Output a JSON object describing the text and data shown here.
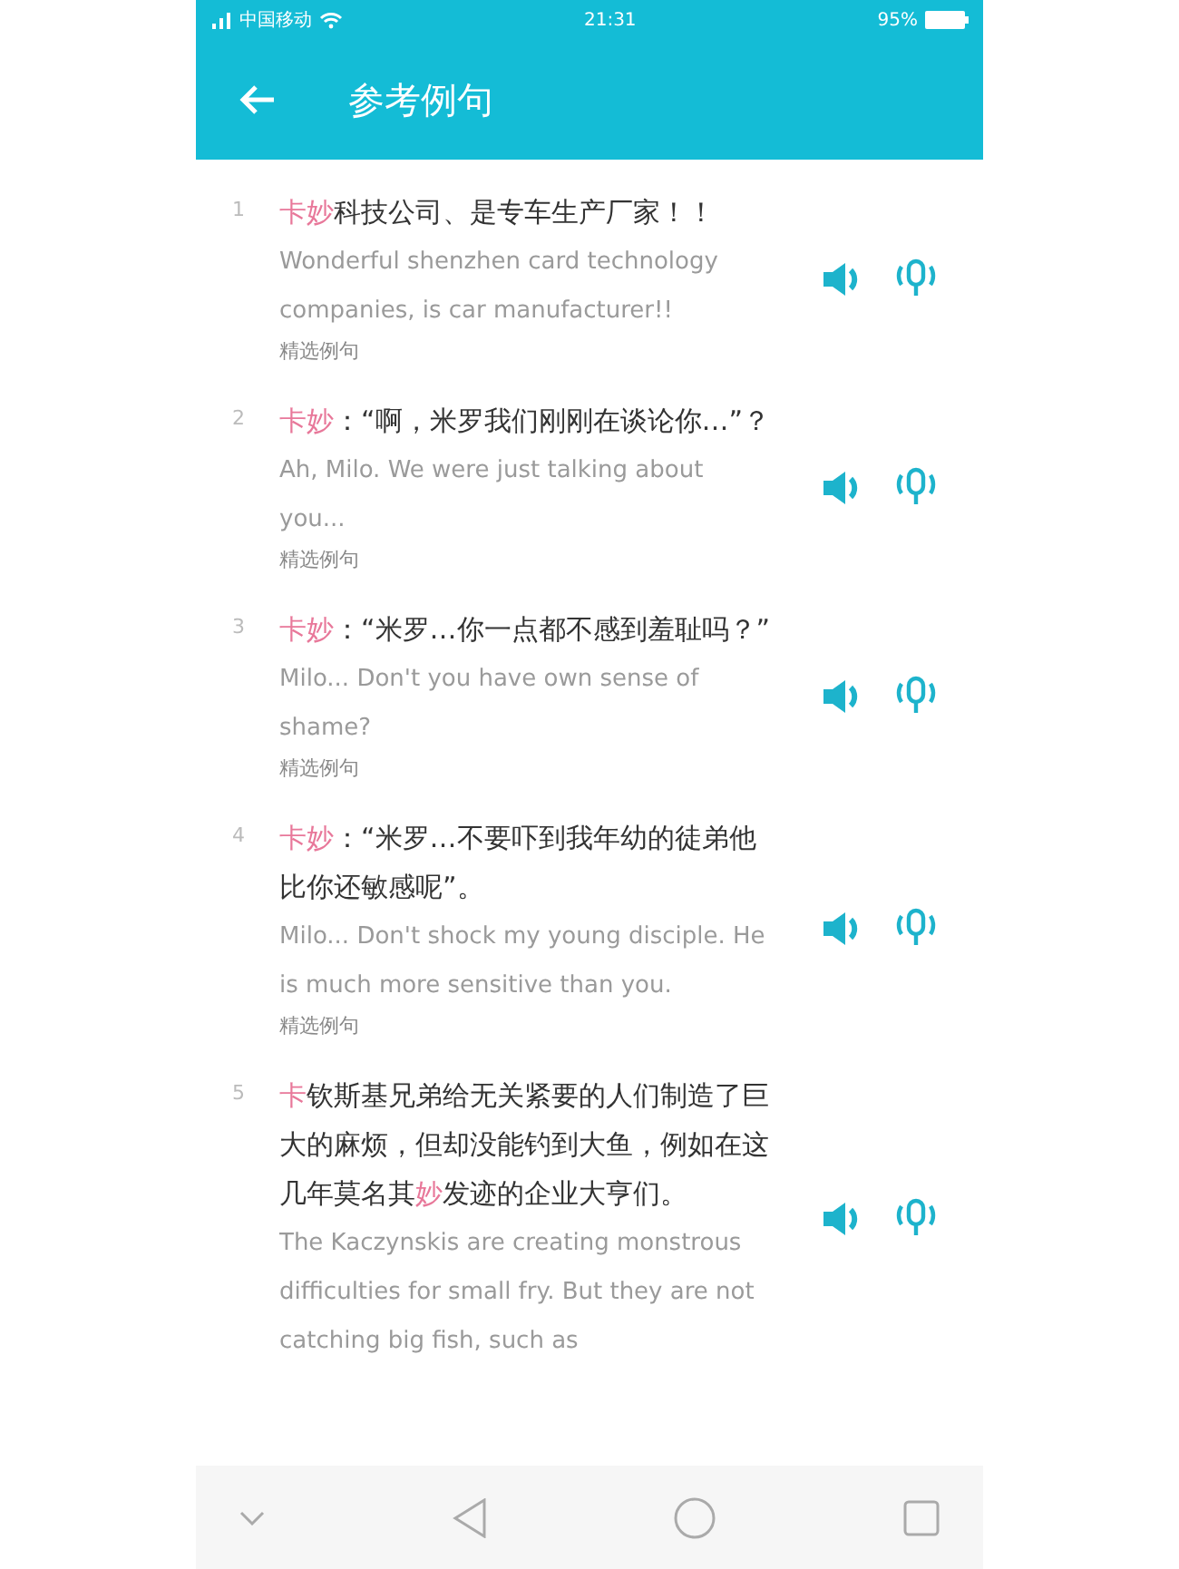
{
  "status_bar": {
    "carrier": "中国移动",
    "time": "21:31",
    "battery": "95%"
  },
  "header": {
    "title": "参考例句"
  },
  "sentences": [
    {
      "number": "1",
      "chinese": [
        {
          "text": "卡妙",
          "highlight": true
        },
        {
          "text": "科技公司、是专车生产厂家！！",
          "highlight": false
        }
      ],
      "english": "Wonderful shenzhen card technology companies, is car manufacturer!!",
      "source": "精选例句"
    },
    {
      "number": "2",
      "chinese": [
        {
          "text": "卡妙",
          "highlight": true
        },
        {
          "text": "：“啊，米罗我们刚刚在谈论你…”？",
          "highlight": false
        }
      ],
      "english": "Ah, Milo. We were just talking about you...",
      "source": "精选例句"
    },
    {
      "number": "3",
      "chinese": [
        {
          "text": "卡妙",
          "highlight": true
        },
        {
          "text": "：“米罗…你一点都不感到羞耻吗？”",
          "highlight": false
        }
      ],
      "english": "Milo... Don't you have own sense of shame?",
      "source": "精选例句"
    },
    {
      "number": "4",
      "chinese": [
        {
          "text": "卡妙",
          "highlight": true
        },
        {
          "text": "：“米罗…不要吓到我年幼的徒弟他比你还敏感呢”。",
          "highlight": false
        }
      ],
      "english": "Milo... Don't shock my young disciple. He is much more sensitive than you.",
      "source": "精选例句"
    },
    {
      "number": "5",
      "chinese": [
        {
          "text": "卡",
          "highlight": true
        },
        {
          "text": "钦斯基兄弟给无关紧要的人们制造了巨大的麻烦，但却没能钓到大鱼，例如在这几年莫名其",
          "highlight": false
        },
        {
          "text": "妙",
          "highlight": true
        },
        {
          "text": "发迹的企业大亨们。",
          "highlight": false
        }
      ],
      "english": "The Kaczynskis are creating monstrous difficulties for small fry. But they are not catching big fish, such as"
    }
  ]
}
